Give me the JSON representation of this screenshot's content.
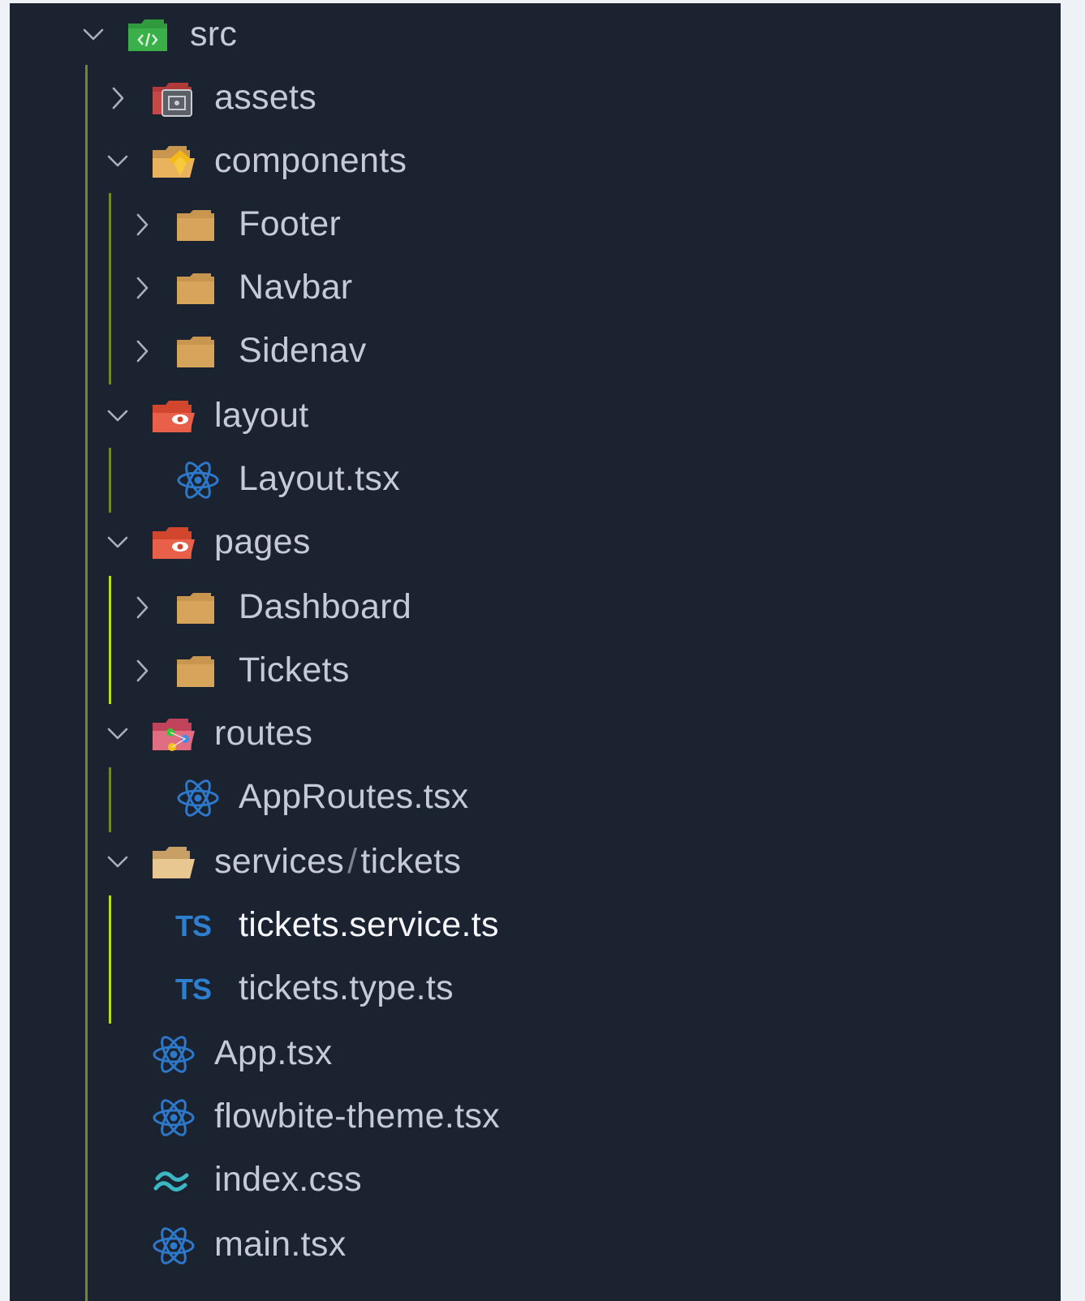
{
  "colors": {
    "panel_bg": "#1b2230",
    "text": "#c4cad6",
    "text_active": "#f4f6fa",
    "indent_rail": "#6e8a2a",
    "indent_rail_active": "#b6dc1e",
    "folder_default": "#c8964e",
    "typescript_blue": "#2f7fd0",
    "react_blue": "#2d78c8"
  },
  "tree": {
    "src": {
      "label": "src",
      "icon": "folder-src-icon"
    },
    "assets": {
      "label": "assets",
      "icon": "folder-assets-icon"
    },
    "components": {
      "label": "components",
      "icon": "folder-components-icon"
    },
    "footer": {
      "label": "Footer",
      "icon": "folder-icon"
    },
    "navbar": {
      "label": "Navbar",
      "icon": "folder-icon"
    },
    "sidenav": {
      "label": "Sidenav",
      "icon": "folder-icon"
    },
    "layout": {
      "label": "layout",
      "icon": "folder-layout-icon"
    },
    "layout_tsx": {
      "label": "Layout.tsx",
      "icon": "react-icon"
    },
    "pages": {
      "label": "pages",
      "icon": "folder-pages-icon"
    },
    "dashboard": {
      "label": "Dashboard",
      "icon": "folder-icon"
    },
    "tickets": {
      "label": "Tickets",
      "icon": "folder-icon"
    },
    "routes": {
      "label": "routes",
      "icon": "folder-routes-icon"
    },
    "approutes_tsx": {
      "label": "AppRoutes.tsx",
      "icon": "react-icon"
    },
    "services": {
      "label_a": "services",
      "label_sep": "/",
      "label_b": "tickets",
      "icon": "folder-open-icon"
    },
    "tickets_service": {
      "label": "tickets.service.ts",
      "icon": "typescript-icon",
      "badge": "TS"
    },
    "tickets_type": {
      "label": "tickets.type.ts",
      "icon": "typescript-icon",
      "badge": "TS"
    },
    "app_tsx": {
      "label": "App.tsx",
      "icon": "react-icon"
    },
    "flowbite_theme": {
      "label": "flowbite-theme.tsx",
      "icon": "react-icon"
    },
    "index_css": {
      "label": "index.css",
      "icon": "tailwind-icon"
    },
    "main_tsx": {
      "label": "main.tsx",
      "icon": "react-icon"
    }
  }
}
